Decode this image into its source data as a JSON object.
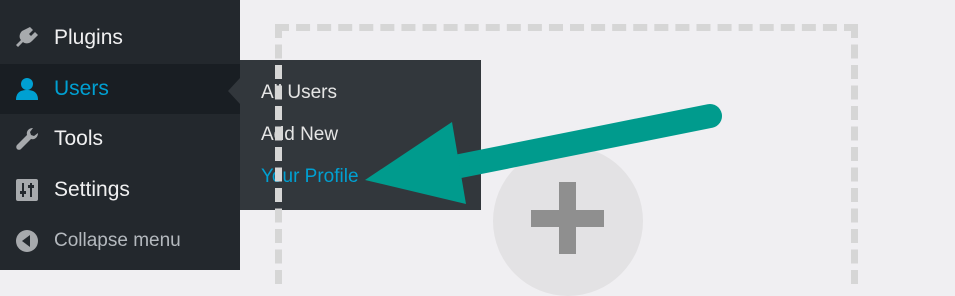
{
  "sidebar": {
    "items": [
      {
        "label": "Plugins",
        "icon": "plugin-icon"
      },
      {
        "label": "Users",
        "icon": "user-icon",
        "active": true
      },
      {
        "label": "Tools",
        "icon": "wrench-icon"
      },
      {
        "label": "Settings",
        "icon": "settings-sliders-icon"
      },
      {
        "label": "Collapse menu",
        "icon": "collapse-arrow-icon"
      }
    ]
  },
  "submenu": {
    "items": [
      {
        "label": "All Users"
      },
      {
        "label": "Add New"
      },
      {
        "label": "Your Profile",
        "current": true
      }
    ]
  },
  "main": {
    "add_icon": "plus-icon"
  },
  "colors": {
    "sidebar_bg": "#23282d",
    "submenu_bg": "#32373c",
    "accent": "#00a0d2",
    "arrow": "#009b8d",
    "content_bg": "#f0eff2"
  }
}
